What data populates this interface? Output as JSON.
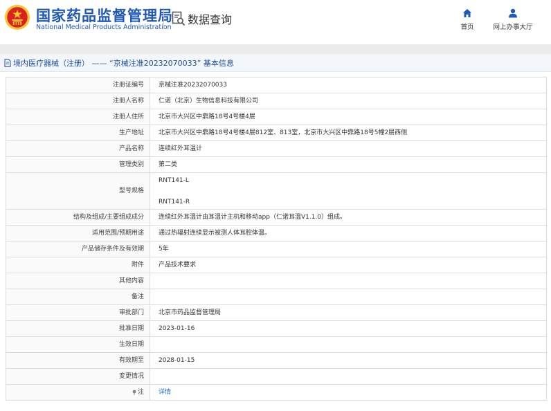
{
  "header": {
    "logo_cn": "国家药品监督管理局",
    "logo_en": "National Medical Products Administration",
    "query_label": "数据查询",
    "nav": [
      {
        "label": "首页",
        "icon": "home-icon"
      },
      {
        "label": "网上办事大厅",
        "icon": "user-icon"
      }
    ]
  },
  "title_bar": {
    "text": "境内医疗器械（注册） —— “京械注准20232070033” 基本信息"
  },
  "colors": {
    "brand_blue": "#1f58b8",
    "link_blue": "#2a6fd6",
    "emblem_red": "#d8231e",
    "emblem_gold": "#f4c431"
  },
  "fields": [
    {
      "key": "注册证编号",
      "value": "京械注准20232070033"
    },
    {
      "key": "注册人名称",
      "value": "仁诺（北京）生物信息科技有限公司"
    },
    {
      "key": "注册人住所",
      "value": "北京市大兴区中鼎路18号4号楼4层"
    },
    {
      "key": "生产地址",
      "value": "北京市大兴区中鼎路18号4号楼4层812室、813室，北京市大兴区中鼎路18号5幢2层西侧"
    },
    {
      "key": "产品名称",
      "value": "连续红外耳温计"
    },
    {
      "key": "管理类别",
      "value": "第二类"
    },
    {
      "key": "型号规格",
      "values": [
        "RNT141-L",
        "RNT141-R"
      ]
    },
    {
      "key": "结构及组成/主要组成成分",
      "value": "连续红外耳温计由耳温计主机和移动app（仁诺耳温V1.1.0）组成。"
    },
    {
      "key": "适用范围/预期用途",
      "value": "通过热辐射连续显示被测人体耳腔体温。"
    },
    {
      "key": "产品储存条件及有效期",
      "value": "5年"
    },
    {
      "key": "附件",
      "value": "产品技术要求"
    },
    {
      "key": "其他内容",
      "value": ""
    },
    {
      "key": "备注",
      "value": ""
    },
    {
      "key": "审批部门",
      "value": "北京市药品监督管理局"
    },
    {
      "key": "批准日期",
      "value": "2023-01-16"
    },
    {
      "key": "生效日期",
      "value": ""
    },
    {
      "key": "有效期至",
      "value": "2028-01-15"
    },
    {
      "key": "变更情况",
      "value": ""
    },
    {
      "key": "注",
      "value": "详情",
      "key_icon": "pin-icon"
    }
  ]
}
